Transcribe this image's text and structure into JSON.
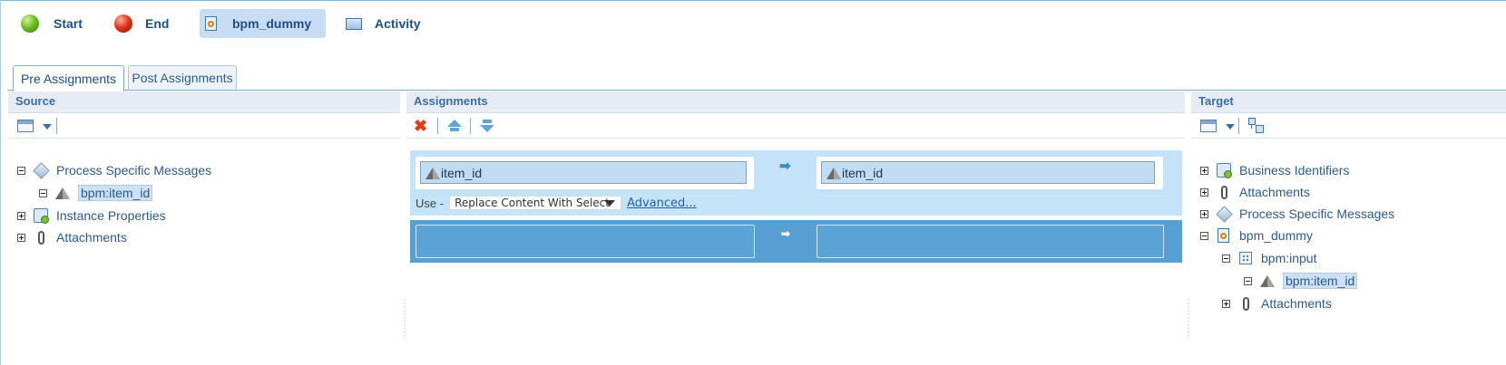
{
  "nodes": [
    {
      "label": "Start",
      "icon": "start-ball-icon",
      "color": "#4caf1a"
    },
    {
      "label": "End",
      "icon": "end-ball-icon",
      "color": "#d8321a"
    },
    {
      "label": "bpm_dummy",
      "icon": "process-doc-icon",
      "selected": true
    },
    {
      "label": "Activity",
      "icon": "activity-icon"
    }
  ],
  "tabs": [
    {
      "label": "Pre Assignments",
      "active": true
    },
    {
      "label": "Post Assignments",
      "active": false
    }
  ],
  "source": {
    "title": "Source",
    "tree": [
      {
        "label": "Process Specific Messages",
        "expanded": true
      },
      {
        "label": "bpm:item_id",
        "selected": true
      },
      {
        "label": "Instance Properties",
        "expanded": false
      },
      {
        "label": "Attachments",
        "expanded": false
      }
    ]
  },
  "assignments": {
    "title": "Assignments",
    "rows": [
      {
        "source": "item_id",
        "target": "item_id",
        "use_label": "Use -",
        "mode": "Replace Content With Select",
        "advanced": "Advanced..."
      },
      {
        "source": "",
        "target": ""
      }
    ]
  },
  "target": {
    "title": "Target",
    "tree": [
      {
        "label": "Business Identifiers",
        "expanded": false
      },
      {
        "label": "Attachments",
        "expanded": false
      },
      {
        "label": "Process Specific Messages",
        "expanded": false
      },
      {
        "label": "bpm_dummy",
        "expanded": true
      },
      {
        "label": "bpm:input",
        "expanded": true
      },
      {
        "label": "bpm:item_id",
        "selected": true
      },
      {
        "label": "Attachments",
        "expanded": false
      }
    ]
  },
  "colors": {
    "header_bg": "#e6ebf5",
    "selected_row": "#c4e2f8",
    "assign_blue": "#559fd2",
    "delete": "#e23b1a"
  }
}
